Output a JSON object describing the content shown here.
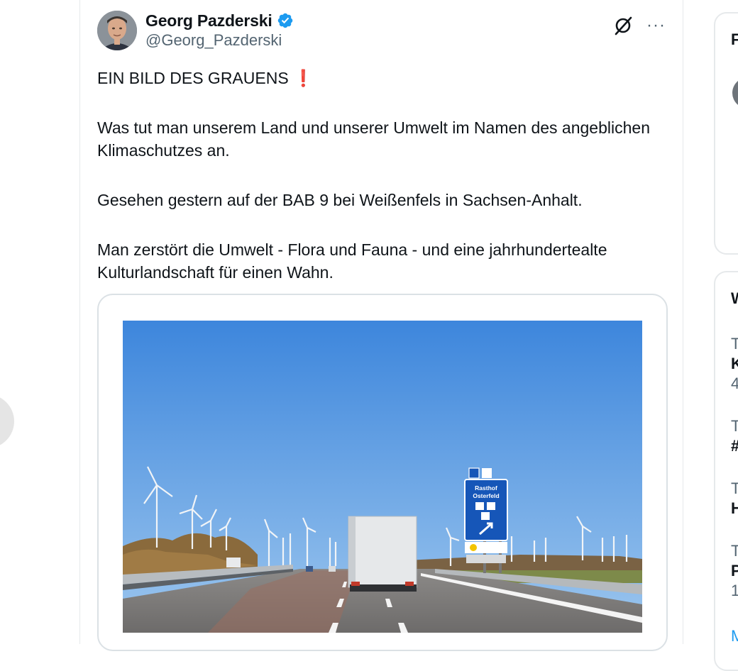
{
  "tweet": {
    "author_name": "Georg Pazderski",
    "author_handle": "@Georg_Pazderski",
    "verified": true,
    "paragraphs": [
      "EIN BILD DES GRAUENS",
      "Was tut man unserem Land und unserer Umwelt im Namen des angeblichen Klimaschutzes an.",
      "Gesehen gestern auf der BAB 9 bei Weißenfels in Sachsen-Anhalt.",
      "Man zerstört die Umwelt - Flora und Fauna - und eine jahrhundertealte Kulturlandschaft für einen Wahn."
    ],
    "headline_emoji": "❗",
    "more_menu": "···",
    "icons": {
      "grok": "grok-slash-icon",
      "more": "more-horizontal-icon",
      "verified": "verified-badge-icon"
    },
    "photo": {
      "sign_title": "Rasthof",
      "sign_subtitle": "Osterfeld"
    }
  },
  "sidebar": {
    "card1_initial": "F",
    "card2_initial": "W",
    "trend_prefixes": [
      "T",
      "T",
      "T",
      "T"
    ],
    "trend_names": [
      "K",
      "#",
      "H",
      "P"
    ],
    "trend_counts": [
      "4",
      "1"
    ],
    "show_more": "M"
  },
  "colors": {
    "accent": "#1d9bf0",
    "text": "#0f1419",
    "secondary": "#536471",
    "sky": "#4f92df",
    "sign_blue": "#1656b8"
  }
}
